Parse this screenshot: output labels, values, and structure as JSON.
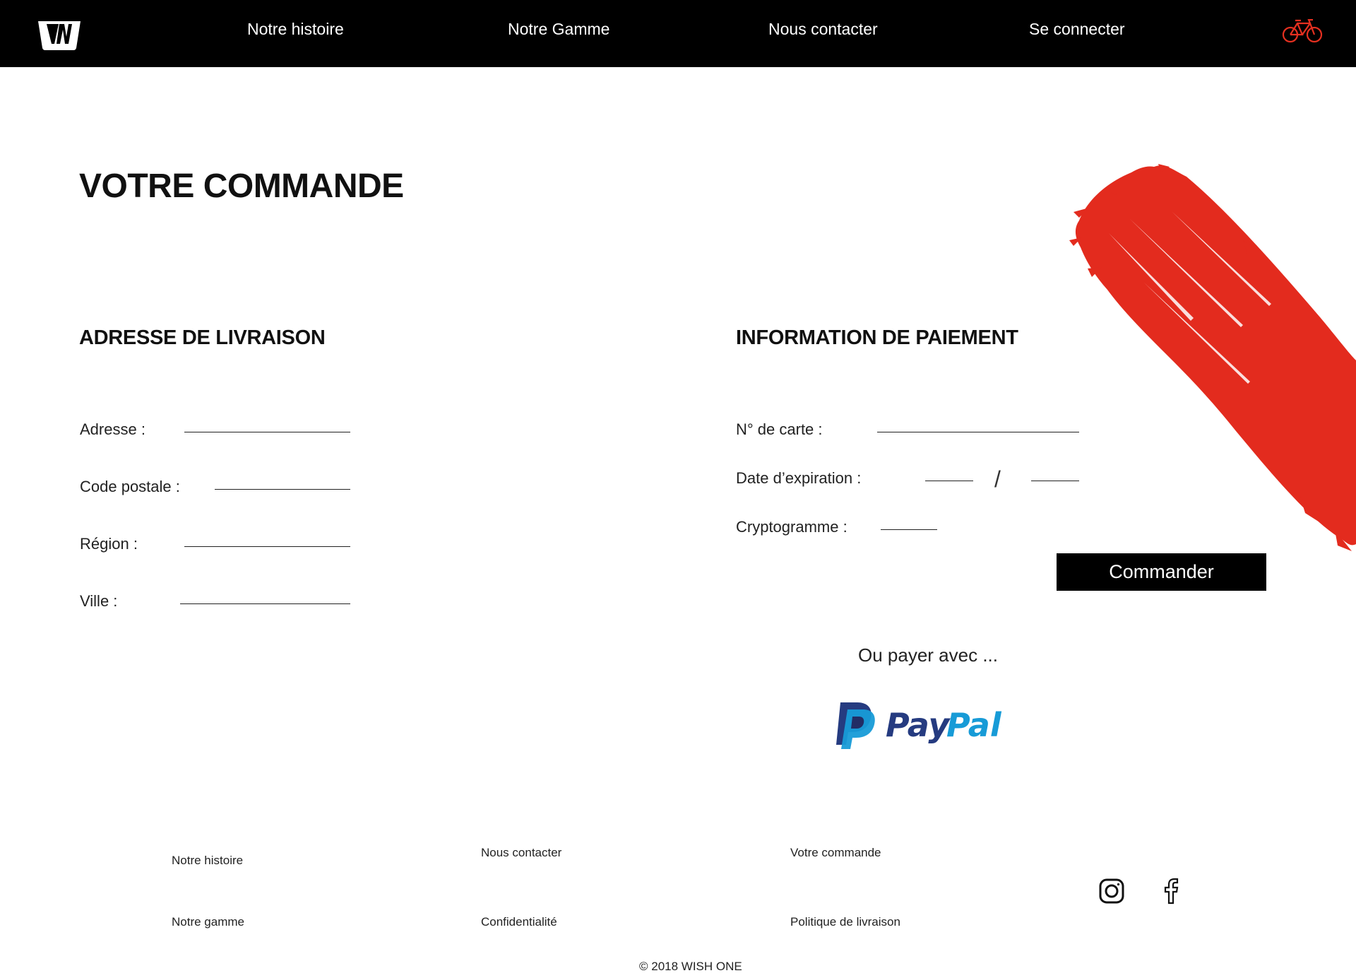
{
  "nav": {
    "links": [
      "Notre histoire",
      "Notre Gamme",
      "Nous contacter",
      "Se connecter"
    ],
    "logo_icon": "wishone-logo-icon",
    "cart_icon": "bicycle-icon",
    "accent_color": "#e53020"
  },
  "page": {
    "title": "VOTRE COMMANDE"
  },
  "shipping": {
    "title": "ADRESSE DE LIVRAISON",
    "fields": [
      {
        "label": "Adresse :",
        "value": ""
      },
      {
        "label": "Code postale :",
        "value": ""
      },
      {
        "label": "Région :",
        "value": ""
      },
      {
        "label": "Ville :",
        "value": ""
      }
    ]
  },
  "payment": {
    "title": "INFORMATION DE PAIEMENT",
    "card_label": "N° de carte :",
    "expiry_label": "Date d’expiration :",
    "expiry_separator": "/",
    "cvv_label": "Cryptogramme :",
    "order_button": "Commander",
    "alt_payment_text": "Ou payer avec ...",
    "paypal_label": "PayPal"
  },
  "footer": {
    "links": [
      "Notre histoire",
      "Notre gamme",
      "Nous contacter",
      "Confidentialité",
      "Votre commande",
      "Politique de livraison"
    ],
    "social_icons": [
      "instagram-icon",
      "facebook-icon"
    ],
    "copyright": "© 2018 WISH ONE"
  }
}
